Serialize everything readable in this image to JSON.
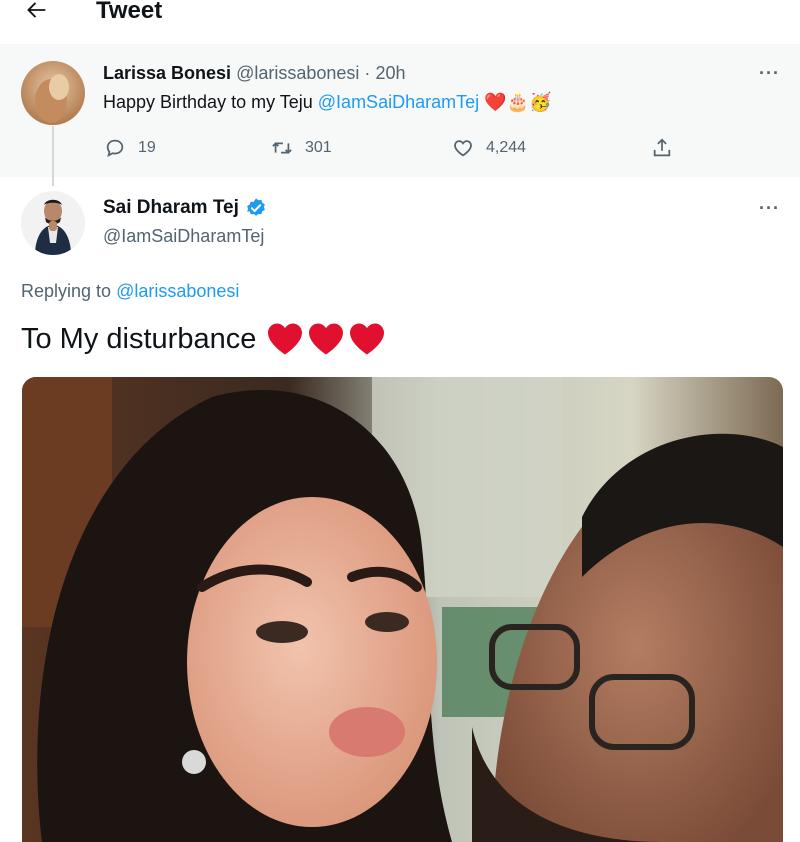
{
  "header": {
    "title": "Tweet",
    "back_icon": "arrow-left-icon"
  },
  "parent_tweet": {
    "display_name": "Larissa Bonesi",
    "handle": "@larissabonesi",
    "separator": "·",
    "time": "20h",
    "text_prefix": "Happy Birthday to my Teju ",
    "mention": "@IamSaiDharamTej",
    "emoji": "❤️🎂🥳",
    "replies": "19",
    "retweets": "301",
    "likes": "4,244",
    "more": "···"
  },
  "main_tweet": {
    "display_name": "Sai Dharam Tej",
    "handle": "@IamSaiDharamTej",
    "verified": true,
    "more": "···",
    "replying_prefix": "Replying to ",
    "replying_handle": "@larissabonesi",
    "text": "To My disturbance",
    "hearts": "❤️❤️❤️"
  },
  "colors": {
    "link": "#1d9bf0",
    "muted": "#536471",
    "heart": "#e0102e",
    "verified": "#1d9bf0"
  }
}
